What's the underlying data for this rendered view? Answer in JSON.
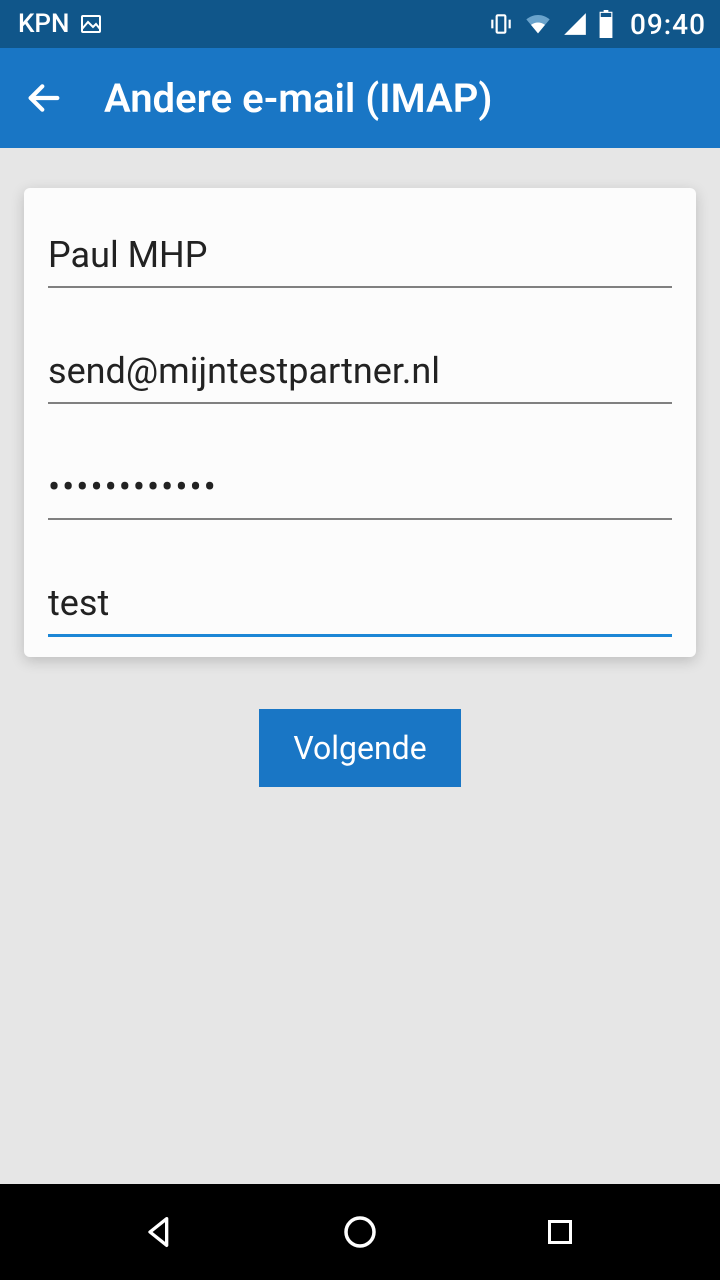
{
  "status": {
    "carrier": "KPN",
    "time": "09:40"
  },
  "appbar": {
    "title": "Andere e-mail (IMAP)"
  },
  "form": {
    "name": "Paul MHP",
    "email": "send@mijntestpartner.nl",
    "password": "••••••••••••",
    "description": "test"
  },
  "buttons": {
    "next": "Volgende"
  }
}
